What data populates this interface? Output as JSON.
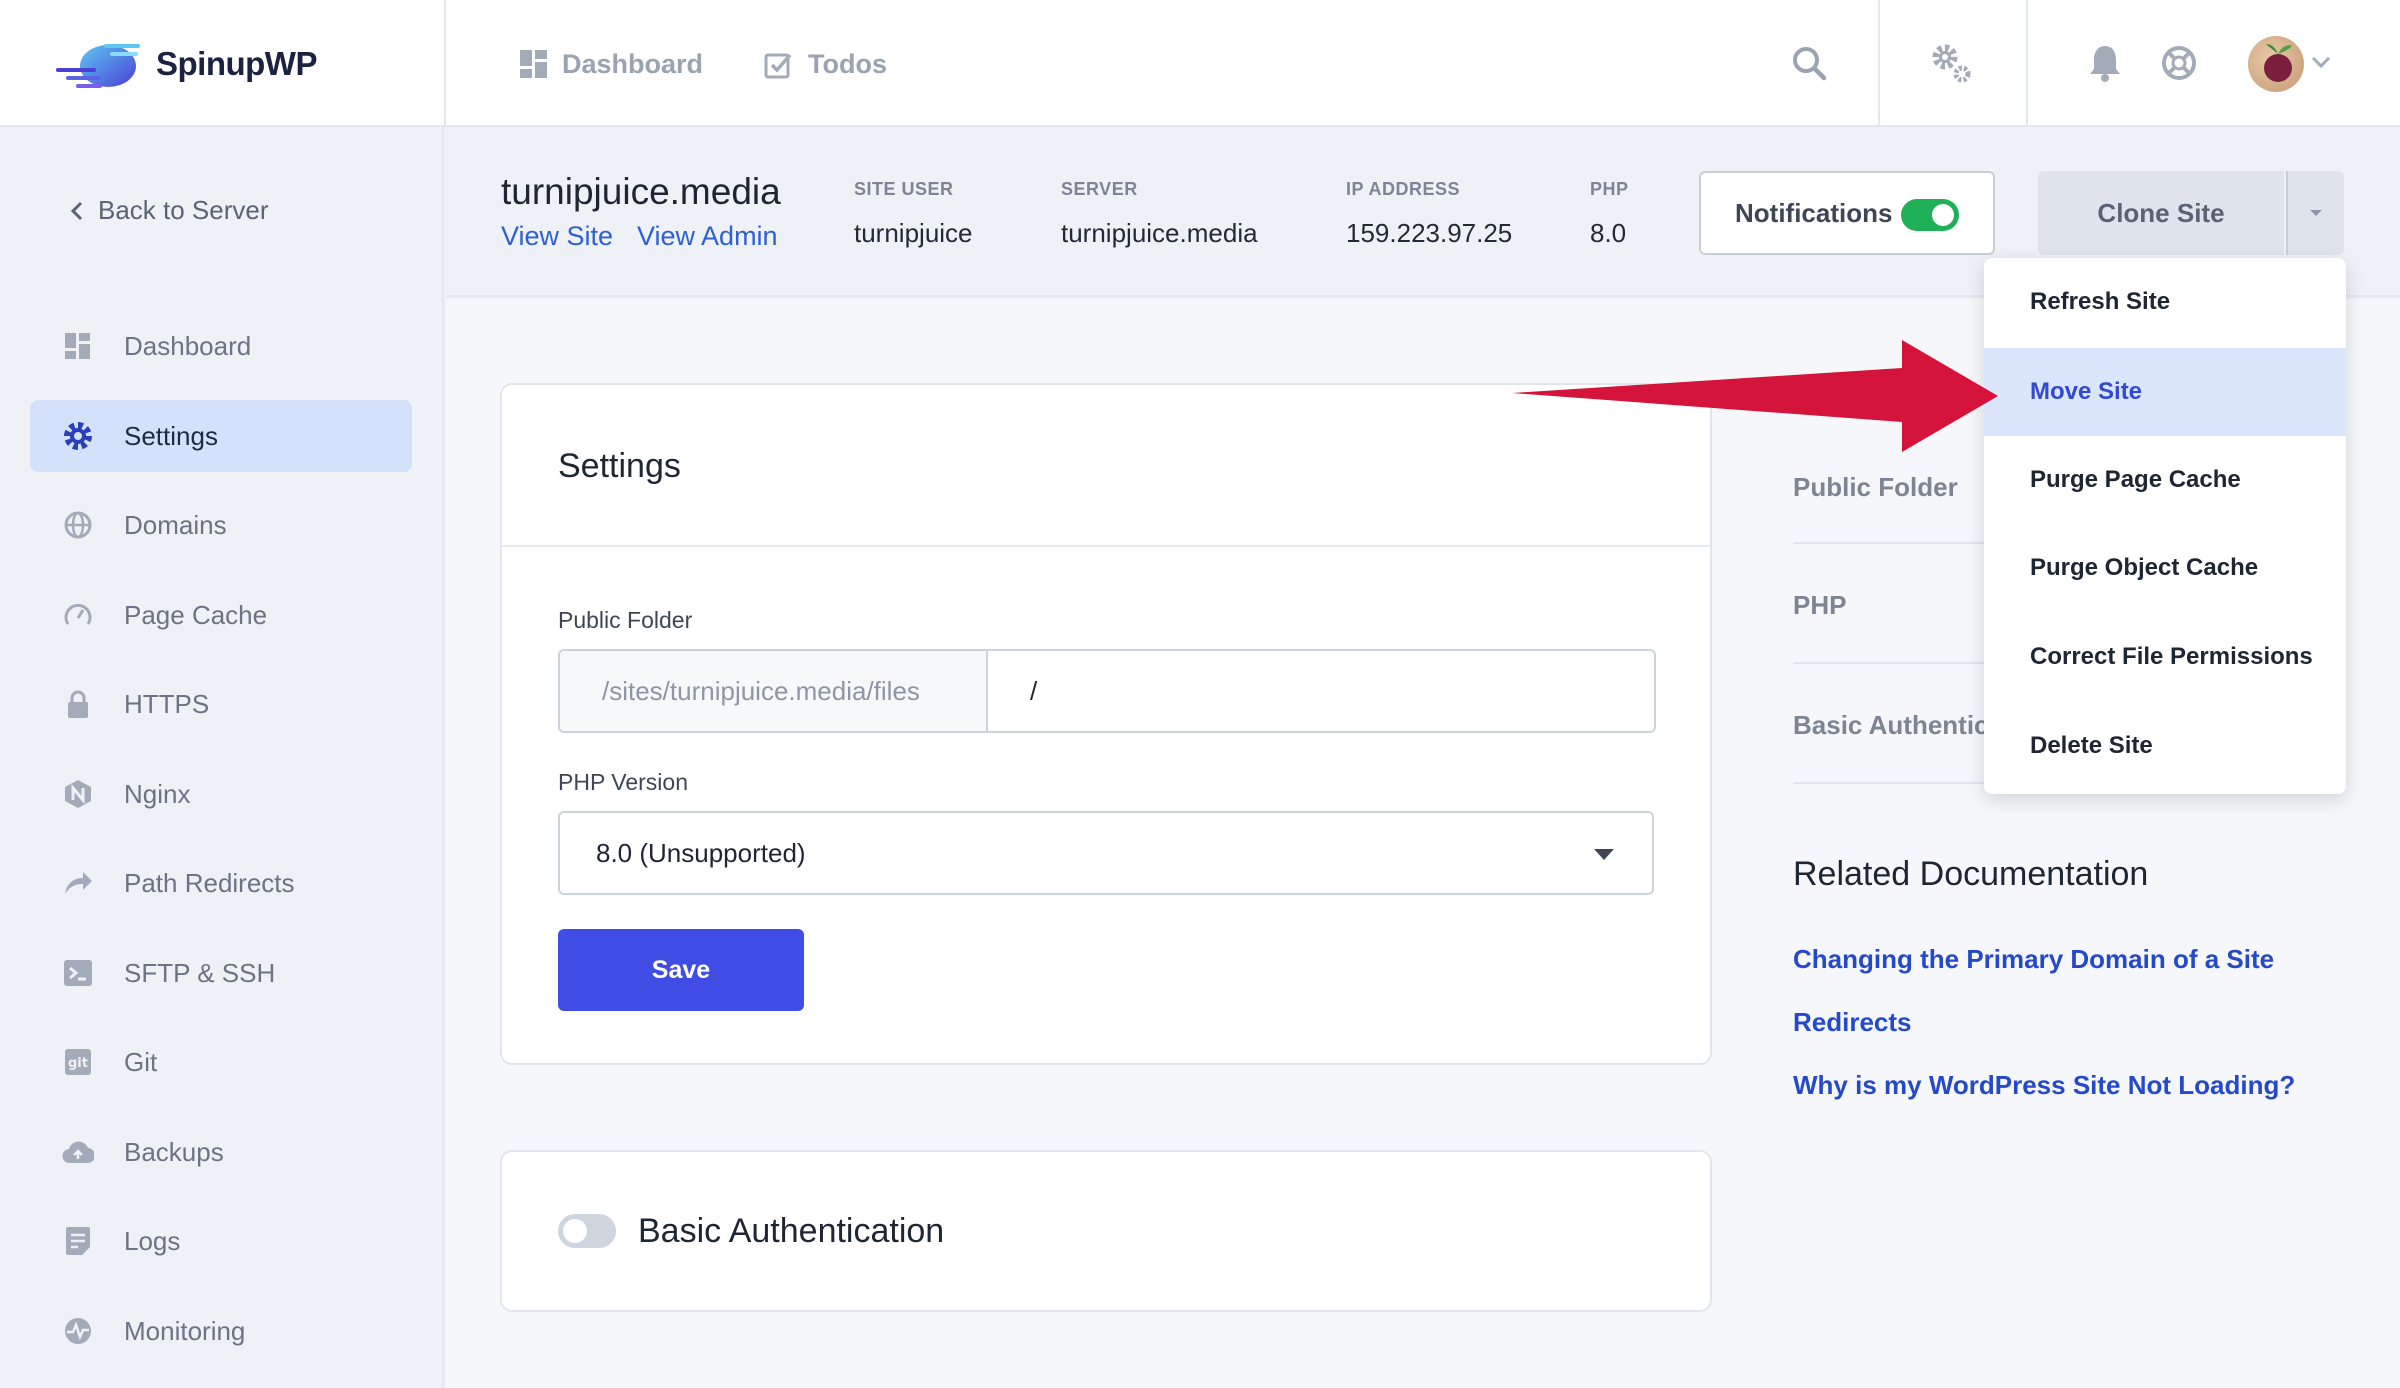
{
  "app": {
    "name": "SpinupWP"
  },
  "topnav": {
    "dashboard": "Dashboard",
    "todos": "Todos"
  },
  "sidebar": {
    "back": "Back to Server",
    "items": [
      {
        "label": "Dashboard",
        "icon": "dashboard-icon"
      },
      {
        "label": "Settings",
        "icon": "gear-icon",
        "active": true
      },
      {
        "label": "Domains",
        "icon": "globe-icon"
      },
      {
        "label": "Page Cache",
        "icon": "gauge-icon"
      },
      {
        "label": "HTTPS",
        "icon": "lock-icon"
      },
      {
        "label": "Nginx",
        "icon": "nginx-icon"
      },
      {
        "label": "Path Redirects",
        "icon": "redirect-icon"
      },
      {
        "label": "SFTP & SSH",
        "icon": "terminal-icon"
      },
      {
        "label": "Git",
        "icon": "git-icon"
      },
      {
        "label": "Backups",
        "icon": "cloud-upload-icon"
      },
      {
        "label": "Logs",
        "icon": "log-icon"
      },
      {
        "label": "Monitoring",
        "icon": "pulse-icon"
      }
    ]
  },
  "site": {
    "title": "turnipjuice.media",
    "view_site": "View Site",
    "view_admin": "View Admin",
    "site_user_label": "SITE USER",
    "site_user": "turnipjuice",
    "server_label": "SERVER",
    "server": "turnipjuice.media",
    "ip_label": "IP ADDRESS",
    "ip": "159.223.97.25",
    "php_label": "PHP",
    "php": "8.0"
  },
  "actions": {
    "notifications": "Notifications",
    "notifications_on": true,
    "clone": "Clone Site"
  },
  "dropdown": {
    "items": [
      "Refresh Site",
      "Move Site",
      "Purge Page Cache",
      "Purge Object Cache",
      "Correct File Permissions",
      "Delete Site"
    ],
    "active_index": 1
  },
  "settings_card": {
    "title": "Settings",
    "public_folder_label": "Public Folder",
    "public_folder_prefix": "/sites/turnipjuice.media/files",
    "public_folder_value": "/",
    "php_version_label": "PHP Version",
    "php_version_value": "8.0 (Unsupported)",
    "save": "Save"
  },
  "auth_card": {
    "title": "Basic Authentication",
    "enabled": false
  },
  "toc": {
    "items": [
      "Public Folder",
      "PHP",
      "Basic Authentic"
    ]
  },
  "related": {
    "title": "Related Documentation",
    "links": [
      "Changing the Primary Domain of a Site",
      "Redirects",
      "Why is my WordPress Site Not Loading?"
    ]
  },
  "colors": {
    "accent": "#3f4de4",
    "link": "#2f5fd0",
    "toggle_on": "#1fb058",
    "arrow": "#d4143a"
  }
}
